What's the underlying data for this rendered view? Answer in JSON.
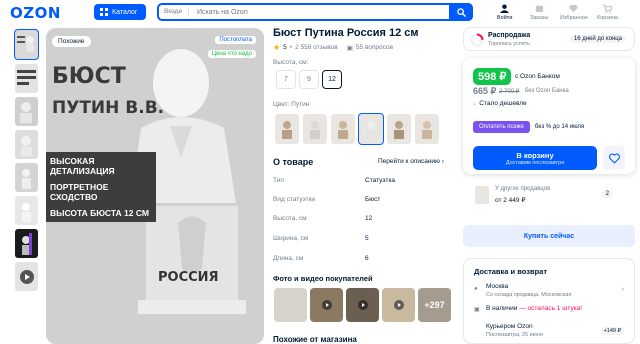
{
  "header": {
    "logo": "OZON",
    "catalog_label": "Каталог",
    "search_scope": "Везде",
    "search_placeholder": "Искать на Ozon",
    "nav": [
      {
        "label": "Войти",
        "icon": "user-icon"
      },
      {
        "label": "Заказы",
        "icon": "box-icon"
      },
      {
        "label": "Избранное",
        "icon": "heart-icon"
      },
      {
        "label": "Корзина",
        "icon": "cart-icon"
      }
    ]
  },
  "gallery": {
    "badge_similar": "Похожие",
    "badge_postpaid": "Постоплата",
    "badge_price": "Цена что надо",
    "image_lines": [
      "БЮСТ",
      "ПУТИН В.В.",
      "ВЫСОКАЯ ДЕТАЛИЗАЦИЯ",
      "ПОРТРЕТНОЕ СХОДСТВО",
      "ВЫСОТА БЮСТА 12 СМ",
      "РОССИЯ"
    ]
  },
  "product": {
    "title": "Бюст Путина Россия 12 см",
    "rating": "5",
    "reviews": "2 558 отзывов",
    "questions": "55 вопросов",
    "height_label": "Высота, см:",
    "heights": [
      "7",
      "9",
      "12"
    ],
    "selected_height": "12",
    "color_label": "Цвет: Путин"
  },
  "about": {
    "title": "О товаре",
    "link": "Перейти к описанию",
    "specs": [
      {
        "k": "Тип",
        "v": "Статуэтка"
      },
      {
        "k": "Вид статуэтки",
        "v": "Бюст"
      },
      {
        "k": "Высота, см",
        "v": "12"
      },
      {
        "k": "Ширина, см",
        "v": "5"
      },
      {
        "k": "Длина, см",
        "v": "6"
      }
    ],
    "photos_title": "Фото и видео покупателей",
    "photos_more": "+297",
    "similar_title": "Похожие от магазина"
  },
  "sidebar": {
    "sale_title": "Распродажа",
    "sale_sub": "Торопись успеть",
    "sale_days": "16 дней до конца",
    "price_ozon": "598 ₽",
    "price_ozon_label": "с Ozon Банком",
    "price_regular": "665 ₽",
    "price_old": "2 700 ₽",
    "price_regular_label": "без Ozon Банка",
    "cheaper": "Стало дешевле",
    "installment_btn": "Оплатить позже",
    "installment_text": "без % до 14 июля",
    "cart_label": "В корзину",
    "cart_sub": "Доставим послезавтра",
    "other_sellers": "У других продавцов",
    "other_price": "от 2 449 ₽",
    "other_count": "2",
    "subscribe_btn": "Купить сейчас",
    "delivery_title": "Доставка и возврат",
    "city": "Москва",
    "city_sub": "Со склада продавца, Московская",
    "stock": "В наличии",
    "stock_note": "— осталась 1 штука!",
    "courier": "Курьером Ozon",
    "courier_sub": "Послезавтра, 25 июня",
    "courier_price": "+149 ₽"
  },
  "colors": {
    "accent": "#005bff",
    "green": "#10c44c",
    "purple": "#7b52f0",
    "text": "#001a34",
    "muted": "#707f8d"
  }
}
